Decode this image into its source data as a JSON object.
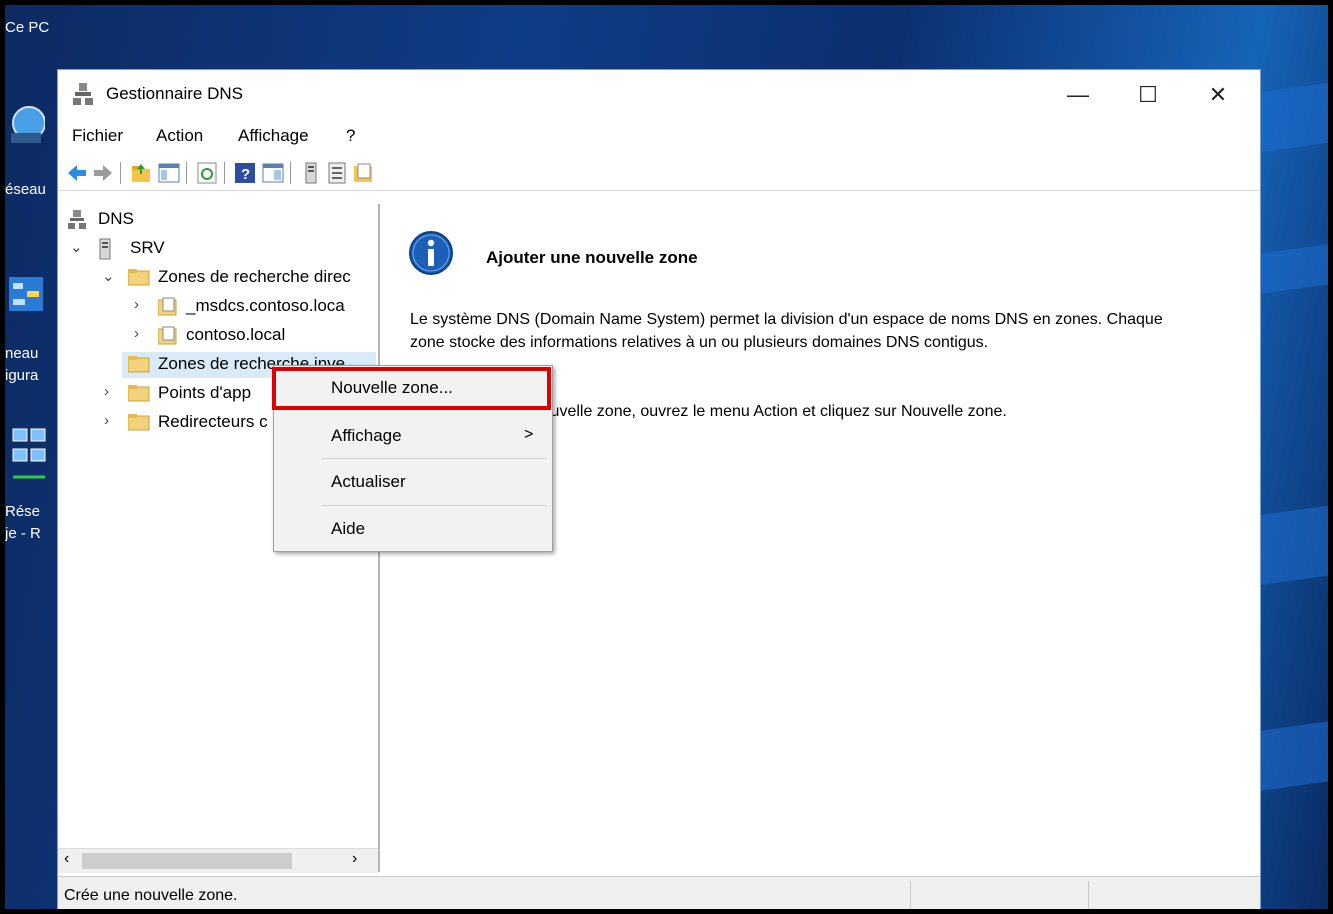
{
  "desktop": {
    "labels": [
      "Ce PC",
      "éseau",
      "neau",
      "igura",
      "Rése",
      "je - R"
    ]
  },
  "window": {
    "title": "Gestionnaire DNS",
    "controls": [
      "—",
      "☐",
      "✕"
    ]
  },
  "menu": {
    "file": "Fichier",
    "action": "Action",
    "view": "Affichage",
    "help": "?"
  },
  "tree": {
    "root": "DNS",
    "server": "SRV",
    "forward_zones": "Zones de recherche direc",
    "msdcs": "_msdcs.contoso.loca",
    "contoso": "contoso.local",
    "reverse_zones": "Zones de recherche inve",
    "trust_points": "Points d'app",
    "forwarders": "Redirecteurs c"
  },
  "main": {
    "heading": "Ajouter une nouvelle zone",
    "para1": "Le système DNS (Domain Name System) permet la division d'un espace de noms DNS en zones. Chaque zone stocke des informations relatives à un ou plusieurs domaines DNS contigus.",
    "para2": "Pour ajouter une nouvelle zone, ouvrez le menu Action et cliquez sur Nouvelle zone."
  },
  "context_menu": {
    "items": [
      {
        "label": "Nouvelle zone..."
      },
      {
        "label": "Affichage",
        "submenu": ">"
      },
      {
        "label": "Actualiser"
      },
      {
        "label": "Aide"
      }
    ]
  },
  "status": {
    "text": "Crée une nouvelle zone."
  },
  "colors": {
    "highlight_border": "#e10000",
    "selection": "#d9ebf9",
    "info_icon": "#1c5fb8"
  }
}
